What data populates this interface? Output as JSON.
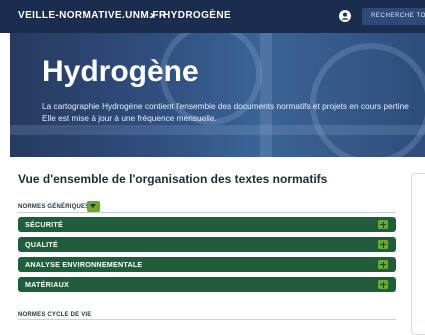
{
  "nav": {
    "site": "VEILLE-NORMATIVE.UNM.FR",
    "separator": "›",
    "breadcrumb": "HYDROGÈNE",
    "search_label": "RECHERCHE TO"
  },
  "hero": {
    "title": "Hydrogène",
    "description_line1": "La cartographie Hydrogène contient l'ensemble des documents normatifs et projets en cours pertine",
    "description_line2": "Elle est mise à jour à une fréquence mensuelle."
  },
  "overview": {
    "title": "Vue d'ensemble de l'organisation des textes normatifs",
    "groups": [
      {
        "label": "NORMES GÉNÉRIQUES",
        "categories": [
          "SÉCURITÉ",
          "QUALITÉ",
          "ANALYSE ENVIRONNEMENTALE",
          "MATÉRIAUX"
        ]
      },
      {
        "label": "NORMES CYCLE DE VIE",
        "categories": []
      }
    ]
  },
  "colors": {
    "navbar": "#1b2d4e",
    "category_bar": "#1f5d3b",
    "accent_green": "#6aa82e"
  }
}
